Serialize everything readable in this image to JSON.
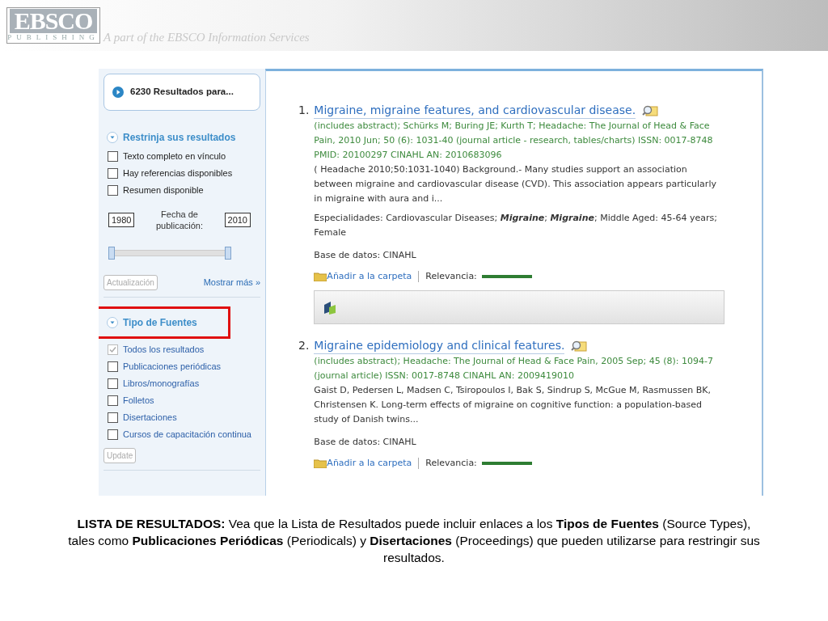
{
  "header": {
    "logo_text": "EBSCO",
    "logo_sub": "PUBLISHING",
    "tagline": "A part of the EBSCO Information Services"
  },
  "sidebar": {
    "results_button": "6230 Resultados para...",
    "refine": {
      "title": "Restrinja sus resultados",
      "options": [
        {
          "label": "Texto completo en vínculo",
          "checked": false
        },
        {
          "label": "Hay referencias disponibles",
          "checked": false
        },
        {
          "label": "Resumen disponible",
          "checked": false
        }
      ],
      "date": {
        "from": "1980",
        "label": "Fecha de publicación:",
        "to": "2010",
        "level": 1
      },
      "update_button": {
        "label": "Actualización",
        "disabled": true
      },
      "more_link": "Mostrar más »"
    },
    "source_types": {
      "title": "Tipo de Fuentes",
      "highlighted": true,
      "options": [
        {
          "label": "Todos los resultados",
          "checked": true,
          "disabled": true
        },
        {
          "label": "Publicaciones periódicas",
          "checked": false,
          "disabled": false
        },
        {
          "label": "Libros/monografías",
          "checked": false,
          "disabled": false
        },
        {
          "label": "Folletos",
          "checked": false,
          "disabled": false
        },
        {
          "label": "Disertaciones",
          "checked": false,
          "disabled": false
        },
        {
          "label": "Cursos de capacitación continua",
          "checked": false,
          "disabled": false
        }
      ],
      "update_button": {
        "label": "Update",
        "disabled": true
      }
    }
  },
  "results": [
    {
      "number": "1.",
      "title": "Migraine, migraine features, and cardiovascular disease.",
      "citation": "(includes abstract); Schürks M; Buring JE; Kurth T; Headache: The Journal of Head & Face Pain, 2010 Jun; 50 (6): 1031-40 (journal article - research, tables/charts) ISSN: 0017-8748 PMID: 20100297 CINAHL AN: 2010683096",
      "abstract": "( Headache 2010;50:1031-1040) Background.- Many studies support an association between migraine and cardiovascular disease (CVD). This association appears particularly in migraine with aura and i...",
      "subjects": "Especialidades: Cardiovascular Diseases; *Migraine*; *Migraine*; Middle Aged: 45-64 years; Female",
      "database": "Base de datos: CINAHL",
      "folder_link": "Añadir a la carpeta",
      "relevance_label": "Relevancia:",
      "level": 1,
      "banner": true
    },
    {
      "number": "2.",
      "title": "Migraine epidemiology and clinical features.",
      "citation": "(includes abstract); Headache: The Journal of Head & Face Pain, 2005 Sep; 45 (8): 1094-7 (journal article) ISSN: 0017-8748 CINAHL AN: 2009419010",
      "abstract": "Gaist D, Pedersen L, Madsen C, Tsiropoulos I, Bak S, Sindrup S, McGue M, Rasmussen BK, Christensen K. Long-term effects of migraine on cognitive function: a population-based study of Danish twins...",
      "database": "Base de datos: CINAHL",
      "folder_link": "Añadir a la carpeta",
      "relevance_label": "Relevancia:",
      "level": 1,
      "banner": false
    }
  ],
  "caption": "**LISTA DE RESULTADOS:** Vea que la Lista de Resultados puede incluir enlaces a los **Tipos de Fuentes** (Source Types), tales como **Publicaciones Periódicas** (Periodicals) y **Disertaciones** (Proceedings) que pueden utilizarse para  restringir sus resultados."
}
